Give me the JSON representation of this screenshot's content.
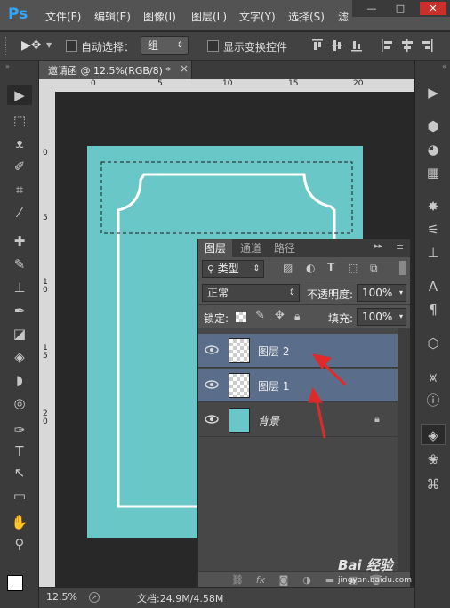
{
  "app": {
    "logo": "Ps"
  },
  "menu": [
    "文件(F)",
    "编辑(E)",
    "图像(I)",
    "图层(L)",
    "文字(Y)",
    "选择(S)",
    "滤"
  ],
  "window_buttons": [
    "—",
    "□",
    "✕"
  ],
  "options": {
    "auto_select_label": "自动选择：",
    "auto_select_value": "组",
    "show_transform_label": "显示变换控件"
  },
  "document": {
    "tab_title": "邀请函 @ 12.5%(RGB/8) *",
    "close": "×",
    "bg_color": "#69c8c7",
    "ruler_top_ticks": [
      "0",
      "5",
      "10",
      "15",
      "20"
    ],
    "ruler_left_ticks": [
      "0",
      "5",
      "1 0",
      "1 5",
      "2 0"
    ]
  },
  "status": {
    "zoom": "12.5%",
    "doc_info": "文档:24.9M/4.58M"
  },
  "layers_panel": {
    "tabs": [
      "图层",
      "通道",
      "路径"
    ],
    "kind_label": "类型",
    "blend_mode": "正常",
    "opacity_label": "不透明度:",
    "opacity_value": "100%",
    "lock_label": "锁定:",
    "fill_label": "填充:",
    "fill_value": "100%",
    "layers": [
      {
        "name": "图层 2",
        "selected": true
      },
      {
        "name": "图层 1",
        "selected": true
      },
      {
        "name": "背景",
        "selected": false
      }
    ]
  },
  "watermark": "Bai 经验",
  "watermark_sub": "jingyan.baidu.com",
  "colors": {
    "accent": "#31a8ff",
    "selected_row": "#5a6d8b",
    "arrow": "#e02a2a"
  }
}
